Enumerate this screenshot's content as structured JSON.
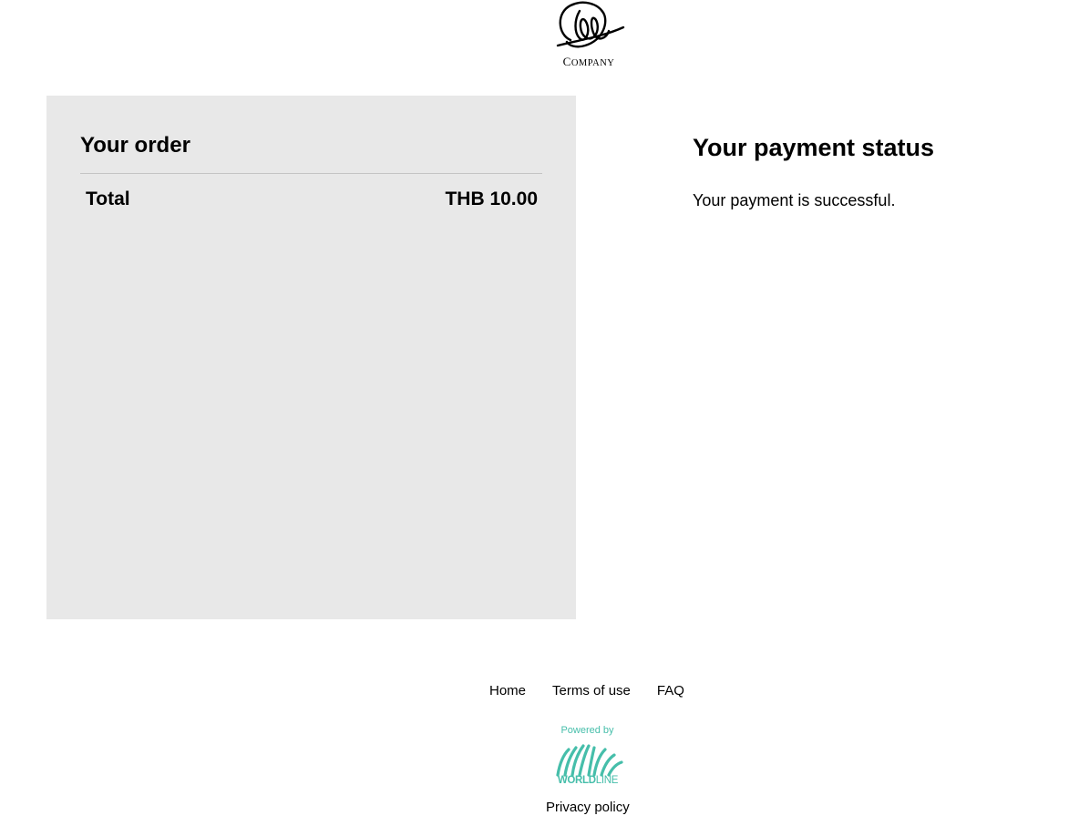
{
  "header": {
    "logo_text": "Company",
    "logo_icon": "company-swirl-logo"
  },
  "order": {
    "title": "Your order",
    "total_label": "Total",
    "total_value": "THB 10.00"
  },
  "status": {
    "title": "Your payment status",
    "message": "Your payment is successful."
  },
  "footer": {
    "links": [
      "Home",
      "Terms of use",
      "FAQ"
    ],
    "powered_by": "Powered by",
    "brand_strong": "WORLD",
    "brand_light": "LINE",
    "privacy": "Privacy policy"
  },
  "colors": {
    "panel_background": "#e8e8e8",
    "brand_teal": "#46beaa"
  }
}
